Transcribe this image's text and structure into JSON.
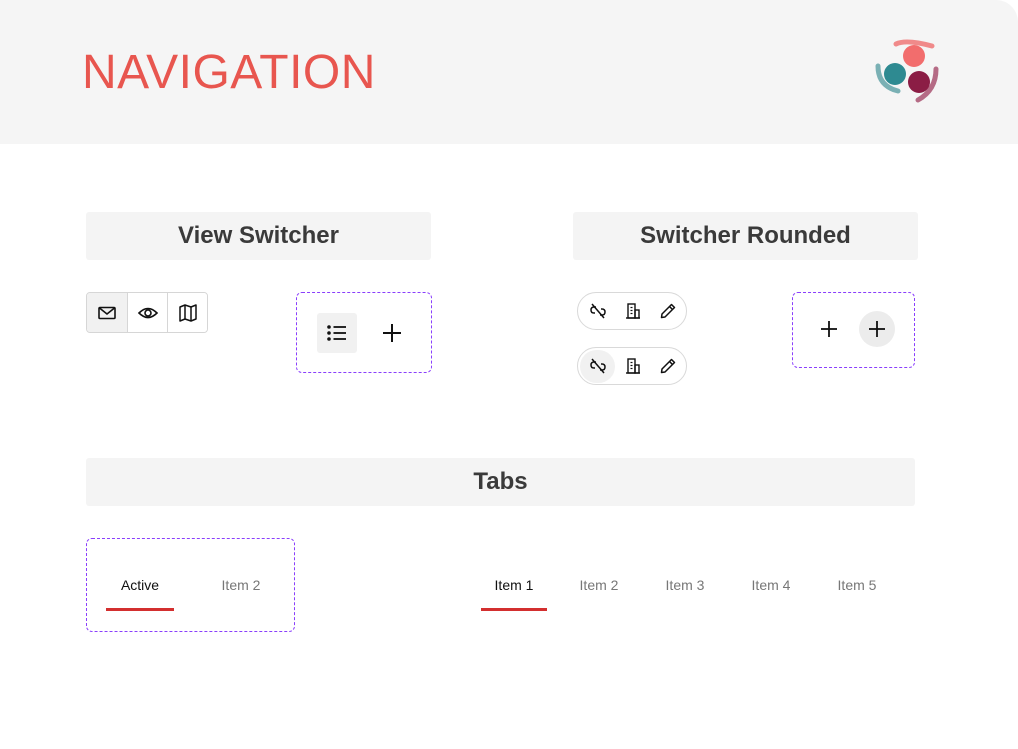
{
  "header": {
    "title": "NAVIGATION"
  },
  "colors": {
    "accent": "#e8564f",
    "tab_indicator": "#d32f2f",
    "dashed_border": "#8a3ffc",
    "logo_coral": "#f26d6d",
    "logo_teal": "#2e8a91",
    "logo_maroon": "#8b1d45"
  },
  "sections": {
    "view_switcher": {
      "title": "View Switcher",
      "group_icons": [
        "mail-icon",
        "eye-icon",
        "map-icon"
      ],
      "active_index": 0,
      "compact_icons": [
        "list-icon",
        "plus-icon"
      ]
    },
    "switcher_rounded": {
      "title": "Switcher Rounded",
      "pill_icons": [
        "unlink-icon",
        "building-icon",
        "pencil-icon"
      ],
      "round_icons": [
        "plus-icon",
        "plus-icon"
      ]
    },
    "tabs": {
      "title": "Tabs",
      "small_tabs": [
        "Active",
        "Item 2"
      ],
      "small_active_index": 0,
      "wide_tabs": [
        "Item 1",
        "Item 2",
        "Item 3",
        "Item 4",
        "Item 5"
      ],
      "wide_active_index": 0
    }
  }
}
